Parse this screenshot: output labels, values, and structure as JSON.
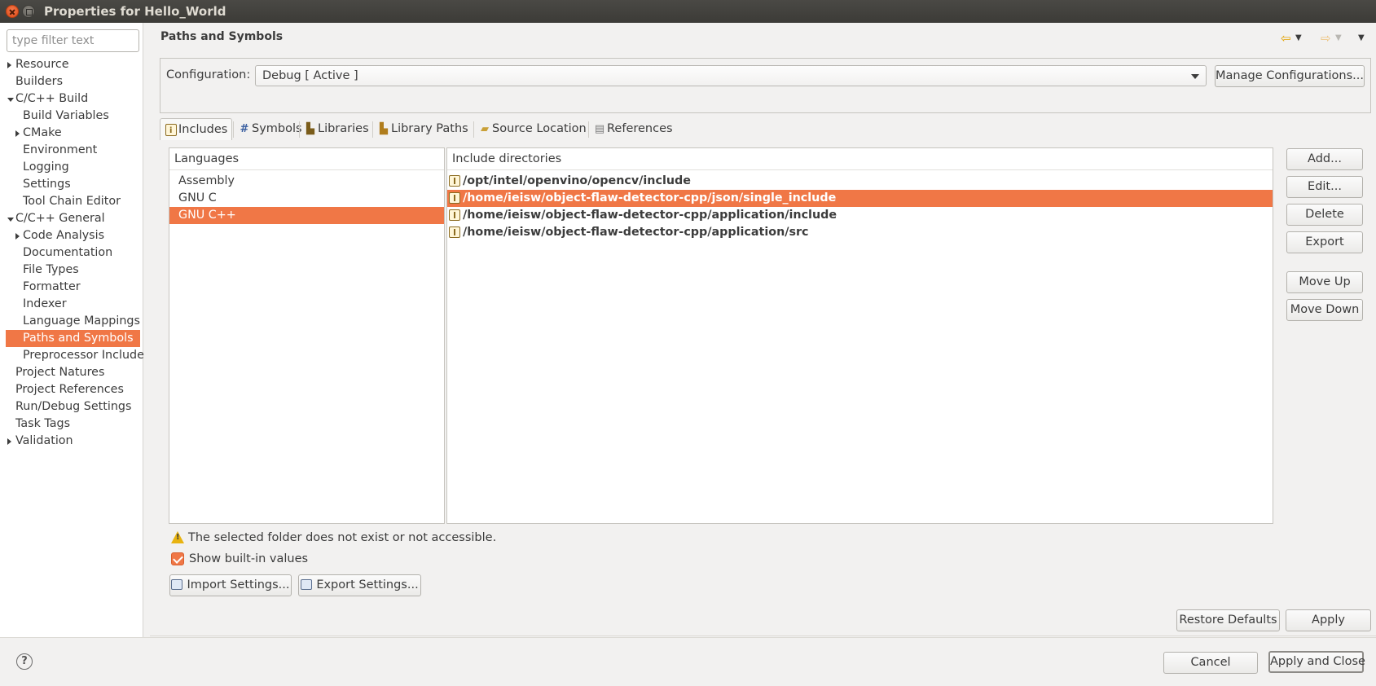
{
  "window": {
    "title": "Properties for Hello_World"
  },
  "left": {
    "filter_placeholder": "type filter text",
    "tree": [
      {
        "label": "Resource",
        "level": 0,
        "twisty": "closed"
      },
      {
        "label": "Builders",
        "level": 0,
        "twisty": "none"
      },
      {
        "label": "C/C++ Build",
        "level": 0,
        "twisty": "open"
      },
      {
        "label": "Build Variables",
        "level": 1,
        "twisty": "none"
      },
      {
        "label": "CMake",
        "level": 1,
        "twisty": "closed"
      },
      {
        "label": "Environment",
        "level": 1,
        "twisty": "none"
      },
      {
        "label": "Logging",
        "level": 1,
        "twisty": "none"
      },
      {
        "label": "Settings",
        "level": 1,
        "twisty": "none"
      },
      {
        "label": "Tool Chain Editor",
        "level": 1,
        "twisty": "none"
      },
      {
        "label": "C/C++ General",
        "level": 0,
        "twisty": "open"
      },
      {
        "label": "Code Analysis",
        "level": 1,
        "twisty": "closed"
      },
      {
        "label": "Documentation",
        "level": 1,
        "twisty": "none"
      },
      {
        "label": "File Types",
        "level": 1,
        "twisty": "none"
      },
      {
        "label": "Formatter",
        "level": 1,
        "twisty": "none"
      },
      {
        "label": "Indexer",
        "level": 1,
        "twisty": "none"
      },
      {
        "label": "Language Mappings",
        "level": 1,
        "twisty": "none"
      },
      {
        "label": "Paths and Symbols",
        "level": 1,
        "twisty": "none",
        "selected": true
      },
      {
        "label": "Preprocessor Include",
        "level": 1,
        "twisty": "none"
      },
      {
        "label": "Project Natures",
        "level": 0,
        "twisty": "none"
      },
      {
        "label": "Project References",
        "level": 0,
        "twisty": "none"
      },
      {
        "label": "Run/Debug Settings",
        "level": 0,
        "twisty": "none"
      },
      {
        "label": "Task Tags",
        "level": 0,
        "twisty": "none"
      },
      {
        "label": "Validation",
        "level": 0,
        "twisty": "closed"
      }
    ]
  },
  "page": {
    "title": "Paths and Symbols",
    "nav_icons": [
      "back-arrow-icon",
      "dropdown-icon",
      "forward-arrow-icon",
      "dropdown-icon",
      "view-menu-icon"
    ],
    "configuration": {
      "label": "Configuration:",
      "value": "Debug  [ Active ]",
      "manage_label": "Manage Configurations..."
    },
    "tabs": [
      {
        "label": "Includes",
        "icon": "include-icon",
        "active": true
      },
      {
        "label": "Symbols",
        "icon": "hash-icon"
      },
      {
        "label": "Libraries",
        "icon": "library-icon"
      },
      {
        "label": "Library Paths",
        "icon": "library-path-icon"
      },
      {
        "label": "Source Location",
        "icon": "folder-icon"
      },
      {
        "label": "References",
        "icon": "reference-icon"
      }
    ],
    "languages": {
      "header": "Languages",
      "items": [
        "Assembly",
        "GNU C",
        "GNU C++"
      ],
      "selected_index": 2
    },
    "includes": {
      "header": "Include directories",
      "items": [
        "/opt/intel/openvino/opencv/include",
        "/home/ieisw/object-flaw-detector-cpp/json/single_include",
        "/home/ieisw/object-flaw-detector-cpp/application/include",
        "/home/ieisw/object-flaw-detector-cpp/application/src"
      ],
      "selected_index": 1
    },
    "side_buttons": {
      "add": "Add...",
      "edit": "Edit...",
      "delete": "Delete",
      "export": "Export",
      "move_up": "Move Up",
      "move_down": "Move Down"
    },
    "warning": "The selected folder does not exist or not accessible.",
    "show_builtin": {
      "label": "Show built-in values",
      "checked": true
    },
    "import_settings": "Import Settings...",
    "export_settings": "Export Settings...",
    "restore_defaults": "Restore Defaults",
    "apply": "Apply"
  },
  "footer": {
    "help": "?",
    "cancel": "Cancel",
    "apply_close": "Apply and Close"
  },
  "colors": {
    "selection": "#f07746",
    "background": "#f2f1f0",
    "titlebar": "#3c3b37"
  }
}
